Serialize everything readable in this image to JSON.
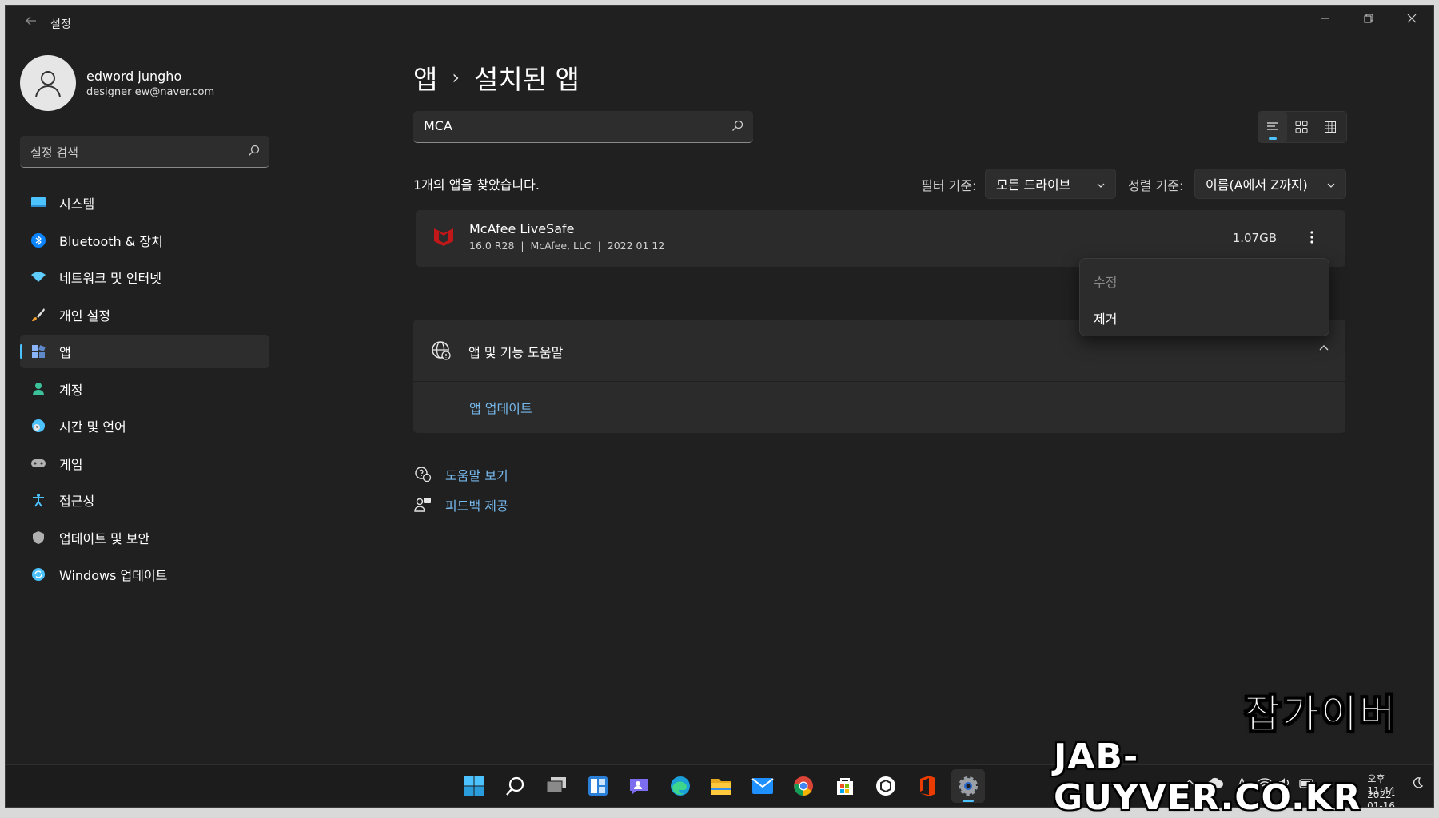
{
  "window": {
    "title": "설정"
  },
  "user": {
    "name": "edword jungho",
    "email": "designer ew@naver.com"
  },
  "sidebar": {
    "search_placeholder": "설정 검색",
    "items": [
      {
        "label": "시스템",
        "icon": "system-icon",
        "color": "#4cc2ff"
      },
      {
        "label": "Bluetooth & 장치",
        "icon": "bluetooth-icon",
        "color": "#0a84ff"
      },
      {
        "label": "네트워크 및 인터넷",
        "icon": "wifi-icon",
        "color": "#60cdff"
      },
      {
        "label": "개인 설정",
        "icon": "brush-icon",
        "color": "#f0a030"
      },
      {
        "label": "앱",
        "icon": "apps-icon",
        "color": "#8ab4f8"
      },
      {
        "label": "계정",
        "icon": "account-icon",
        "color": "#3cc29a"
      },
      {
        "label": "시간 및 언어",
        "icon": "globe-clock-icon",
        "color": "#4cc2ff"
      },
      {
        "label": "게임",
        "icon": "gamepad-icon",
        "color": "#b0b0b0"
      },
      {
        "label": "접근성",
        "icon": "accessibility-icon",
        "color": "#4cc2ff"
      },
      {
        "label": "업데이트 및 보안",
        "icon": "shield-icon",
        "color": "#b0b0b0"
      },
      {
        "label": "Windows 업데이트",
        "icon": "refresh-icon",
        "color": "#4cc2ff"
      }
    ],
    "active_index": 4
  },
  "breadcrumb": {
    "parent": "앱",
    "separator": "›",
    "current": "설치된 앱"
  },
  "search": {
    "value": "MCA"
  },
  "result_count": "1개의 앱을 찾았습니다.",
  "filter": {
    "label": "필터 기준:",
    "value": "모든 드라이브"
  },
  "sort": {
    "label": "정렬 기준:",
    "value": "이름(A에서 Z까지)"
  },
  "app": {
    "name": "McAfee LiveSafe",
    "meta": "16.0 R28  |  McAfee, LLC  |  2022 01 12",
    "size": "1.07GB"
  },
  "context_menu": {
    "modify": "수정",
    "uninstall": "제거"
  },
  "help": {
    "title": "앱 및 기능 도움말",
    "link": "앱 업데이트"
  },
  "links": {
    "get_help": "도움말 보기",
    "feedback": "피드백 제공"
  },
  "taskbar": {
    "time": "오후 11:44",
    "date": "2022-01-16",
    "ime": "A"
  },
  "watermark": {
    "korean": "잡가이버",
    "url": "JAB-GUYVER.CO.KR"
  },
  "colors": {
    "accent": "#4cc2ff",
    "link": "#76b9ed",
    "mcafee": "#c01818"
  }
}
